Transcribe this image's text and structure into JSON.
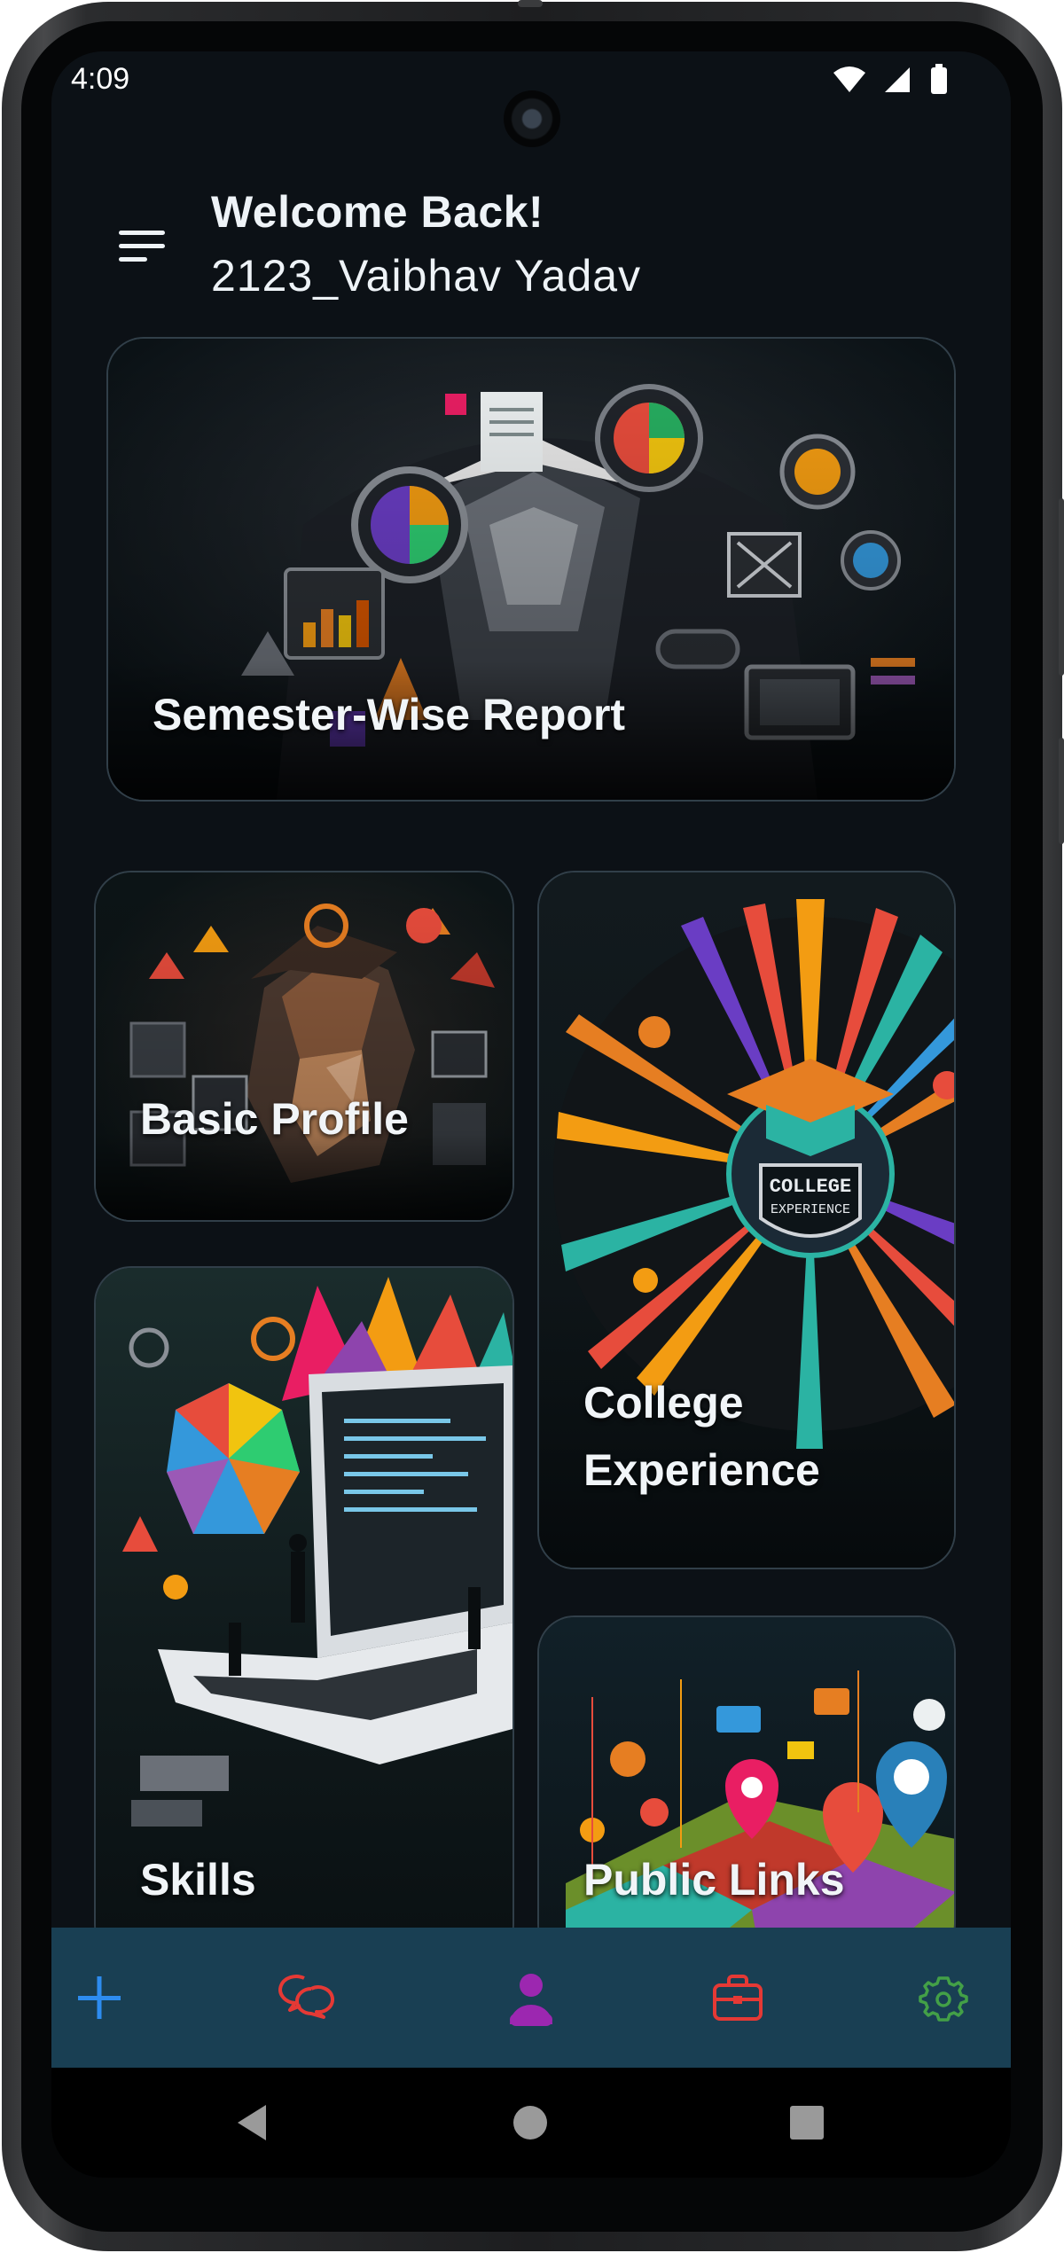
{
  "status_bar": {
    "time": "4:09",
    "icons": [
      "wifi-icon",
      "cellular-signal-icon",
      "battery-icon"
    ]
  },
  "header": {
    "menu_icon": "hamburger-menu-icon",
    "greeting": "Welcome Back!",
    "username": "2123_Vaibhav Yadav"
  },
  "cards": {
    "semester": {
      "label": "Semester-Wise Report"
    },
    "basic_profile": {
      "label": "Basic Profile"
    },
    "college_experience": {
      "label_line1": "College",
      "label_line2": "Experience",
      "badge_line1": "COLLEGE",
      "badge_line2": "EXPERIENCE"
    },
    "skills": {
      "label": "Skills"
    },
    "public_links": {
      "label": "Public Links"
    }
  },
  "bottom_nav": {
    "items": [
      {
        "icon": "add-icon",
        "color": "#2d8cf0"
      },
      {
        "icon": "chat-bubbles-icon",
        "color": "#e53935"
      },
      {
        "icon": "profile-icon",
        "color": "#9c27b0"
      },
      {
        "icon": "briefcase-icon",
        "color": "#e53935"
      },
      {
        "icon": "settings-gear-icon",
        "color": "#43a047"
      }
    ],
    "background": "#193f53"
  },
  "system_nav": {
    "icons": [
      "back-triangle-icon",
      "home-circle-icon",
      "recents-square-icon"
    ]
  },
  "colors": {
    "screen_background": "#0c1116",
    "text": "#eef3f7"
  }
}
